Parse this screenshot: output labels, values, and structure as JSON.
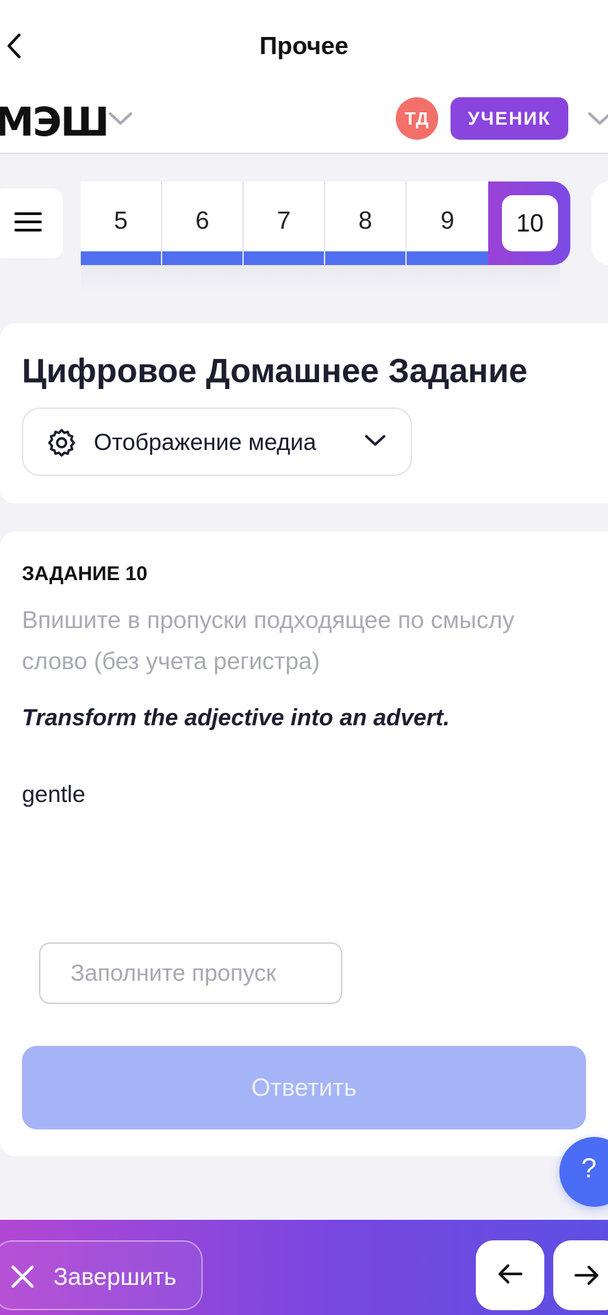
{
  "nav": {
    "title": "Прочее",
    "back_icon": "chevron-left-icon"
  },
  "header": {
    "logo": "МЭШ",
    "avatar_initials": "ТД",
    "role": "УЧЕНИК",
    "colors": {
      "avatar": "#f27069",
      "role_badge": "#8945dd"
    }
  },
  "task_nav": {
    "menu_icon": "hamburger-icon",
    "tiles": [
      {
        "label": "5",
        "completed": true
      },
      {
        "label": "6",
        "completed": true
      },
      {
        "label": "7",
        "completed": true
      },
      {
        "label": "8",
        "completed": true
      },
      {
        "label": "9",
        "completed": true
      },
      {
        "label": "10",
        "completed": false,
        "active": true
      }
    ],
    "colors": {
      "progress": "#4f6ff0"
    }
  },
  "card": {
    "title": "Цифровое Домашнее Задание",
    "media_select": {
      "label": "Отображение медиа",
      "icon": "gear-icon"
    }
  },
  "task": {
    "label": "ЗАДАНИЕ 10",
    "instruction": "Впишите в пропуски подходящее по смыслу слово (без учета регистра)",
    "prompt": "Transform the adjective into an advert.",
    "word": "gentle",
    "input_value": "",
    "input_placeholder": "Заполните пропуск",
    "submit_label": "Ответить",
    "colors": {
      "submit_disabled": "#a4b4f6"
    }
  },
  "help": {
    "label": "?"
  },
  "footer": {
    "finish_label": "Завершить",
    "prev_icon": "arrow-left-icon",
    "next_icon": "arrow-right-icon"
  }
}
